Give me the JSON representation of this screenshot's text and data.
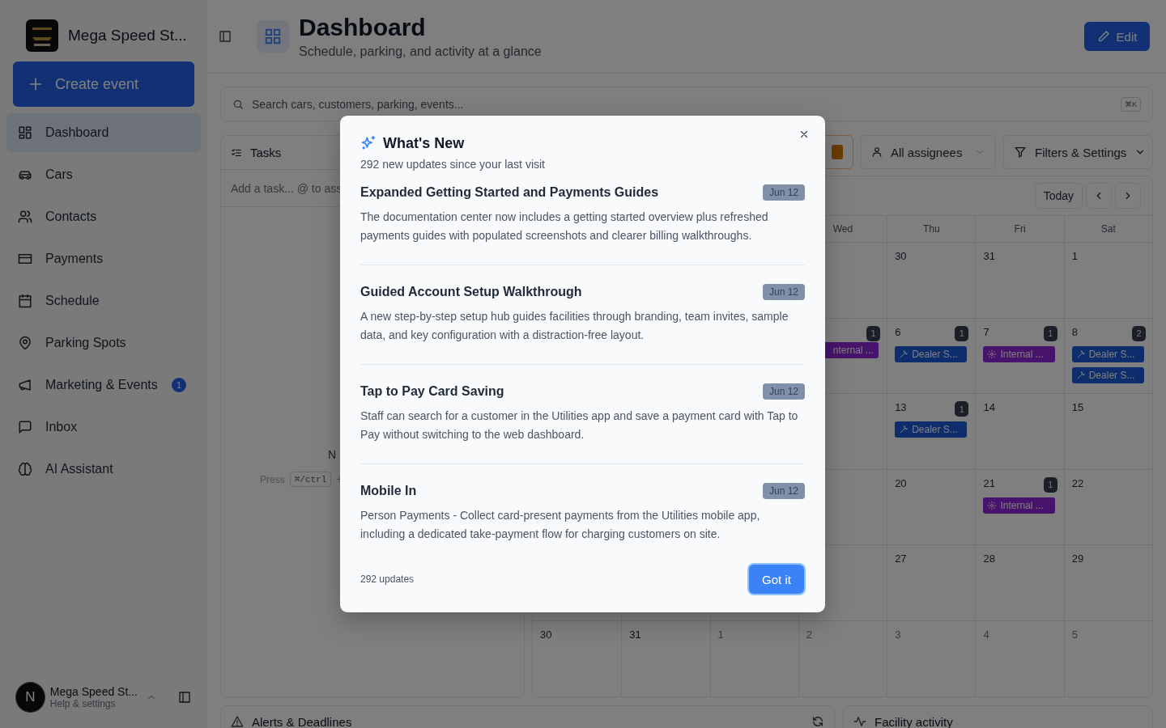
{
  "sidebar": {
    "brand": "Mega Speed St...",
    "create_button": "Create event",
    "items": [
      {
        "label": "Dashboard",
        "selected": true
      },
      {
        "label": "Cars",
        "selected": false
      },
      {
        "label": "Contacts",
        "selected": false
      },
      {
        "label": "Payments",
        "selected": false
      },
      {
        "label": "Schedule",
        "selected": false
      },
      {
        "label": "Parking Spots",
        "selected": false
      },
      {
        "label": "Marketing & Events",
        "selected": false,
        "badge": "1"
      },
      {
        "label": "Inbox",
        "selected": false
      },
      {
        "label": "AI Assistant",
        "selected": false
      }
    ],
    "account": {
      "initial": "N",
      "name": "Mega Speed St...",
      "subtitle": "Help & settings"
    }
  },
  "header": {
    "title": "Dashboard",
    "subtitle": "Schedule, parking, and activity at a glance",
    "edit_button": "Edit"
  },
  "search": {
    "placeholder": "Search cars, customers, parking, events...",
    "shortcut": "⌘K"
  },
  "tasks": {
    "title": "Tasks",
    "input_placeholder": "Add a task... @ to ass",
    "empty_text": "N",
    "hint_prefix": "Press",
    "hint_key": "⌘/ctrl",
    "hint_plus": "+"
  },
  "filters": {
    "assignees": "All assignees",
    "settings": "Filters & Settings"
  },
  "calendar": {
    "today": "Today",
    "weekdays": [
      "Wed",
      "Thu",
      "Fri",
      "Sat"
    ],
    "weeks": [
      {
        "days": [
          {
            "date": "30"
          },
          {
            "date": "31"
          },
          {
            "date": "1"
          }
        ]
      },
      {
        "days": [
          {
            "count": "1",
            "events": [
              {
                "kind": "internal",
                "label": "nternal ...",
                "clipped": true
              }
            ]
          },
          {
            "date": "6",
            "count": "1",
            "events": [
              {
                "kind": "dealer",
                "label": "Dealer S..."
              }
            ]
          },
          {
            "date": "7",
            "count": "1",
            "events": [
              {
                "kind": "internal",
                "label": "Internal ..."
              }
            ]
          },
          {
            "date": "8",
            "count": "2",
            "events": [
              {
                "kind": "dealer",
                "label": "Dealer S..."
              },
              {
                "kind": "dealer",
                "label": "Dealer S..."
              }
            ]
          }
        ]
      },
      {
        "days": [
          {
            "date": "13",
            "count": "1",
            "events": [
              {
                "kind": "dealer",
                "label": "Dealer S..."
              }
            ]
          },
          {
            "date": "14"
          },
          {
            "date": "15"
          }
        ]
      },
      {
        "days": [
          {
            "date": "20"
          },
          {
            "date": "21",
            "count": "1",
            "events": [
              {
                "kind": "internal",
                "label": "Internal ..."
              }
            ]
          },
          {
            "date": "22"
          }
        ]
      },
      {
        "days": [
          {
            "date": "27"
          },
          {
            "date": "28"
          },
          {
            "date": "29"
          }
        ]
      },
      {
        "days": [
          {
            "date": "30",
            "muted": false
          },
          {
            "date": "31",
            "muted": false
          },
          {
            "date": "1",
            "muted": true
          },
          {
            "date": "2",
            "muted": true
          },
          {
            "date": "3",
            "muted": true
          },
          {
            "date": "4",
            "muted": true
          },
          {
            "date": "5",
            "muted": true
          }
        ]
      }
    ]
  },
  "bottom": {
    "alerts": "Alerts & Deadlines",
    "activity": "Facility activity"
  },
  "whats_new": {
    "title": "What's New",
    "subtitle": "292 new updates since your last visit",
    "items": [
      {
        "title": "Expanded Getting Started and Payments Guides",
        "date": "Jun 12",
        "text": "The documentation center now includes a getting started overview plus refreshed payments guides with populated screenshots and clearer billing walkthroughs."
      },
      {
        "title": "Guided Account Setup Walkthrough",
        "date": "Jun 12",
        "text": "A new step-by-step setup hub guides facilities through branding, team invites, sample data, and key configuration with a distraction-free layout."
      },
      {
        "title": "Tap to Pay Card Saving",
        "date": "Jun 12",
        "text": "Staff can search for a customer in the Utilities app and save a payment card with Tap to Pay without switching to the web dashboard."
      },
      {
        "title": "Mobile In",
        "date": "Jun 12",
        "text": "Person Payments - Collect card-present payments from the Utilities mobile app, including a dedicated take-payment flow for charging customers on site."
      }
    ],
    "footer": "292 updates",
    "button": "Got it"
  }
}
